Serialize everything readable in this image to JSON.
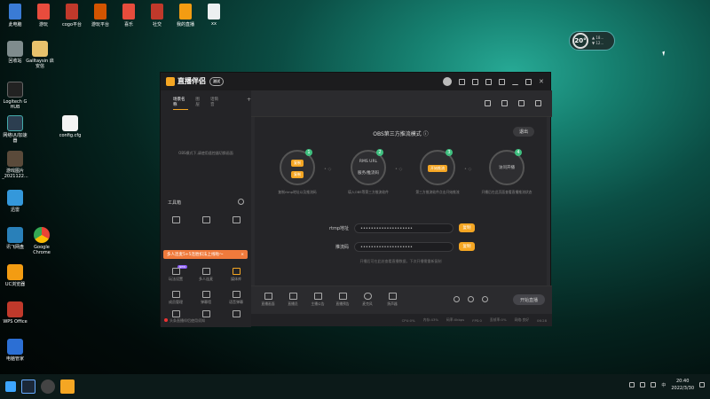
{
  "desktop": {
    "top_icons": [
      {
        "label": "此电脑",
        "color": "#3a7bd5"
      },
      {
        "label": "游玩",
        "color": "#e84c3d"
      },
      {
        "label": "cogo平台",
        "color": "#c0392b"
      },
      {
        "label": "游玩平台",
        "color": "#d35400"
      },
      {
        "label": "喜乐",
        "color": "#e74c3c"
      },
      {
        "label": "社交",
        "color": "#c0392b"
      },
      {
        "label": "我的直播",
        "color": "#f39c12"
      },
      {
        "label": "xx",
        "color": "#ecf0f1"
      }
    ],
    "left_icons": [
      {
        "label": "回收站",
        "color": "#7f8c8d"
      },
      {
        "label": "Logitech G HUB",
        "color": "#222"
      },
      {
        "label": "网络UU加速器",
        "color": "#2c3e50"
      },
      {
        "label": "游戏图片 _2021122...",
        "color": "#5a4a3a"
      },
      {
        "label": "迅雷",
        "color": "#3498db"
      },
      {
        "label": "讯飞网盘",
        "color": "#2980b9"
      },
      {
        "label": "UC浏览器",
        "color": "#f39c12"
      },
      {
        "label": "WPS Office",
        "color": "#c0392b"
      },
      {
        "label": "电脑管家",
        "color": "#2c6fd4"
      }
    ],
    "extra_icons": [
      {
        "label": "Galltaysin 启安信",
        "color": "#e8c26c"
      },
      {
        "label": "config.cfg",
        "color": "#f4f4f4"
      },
      {
        "label": "Google Chrome",
        "color": "#4285f4"
      }
    ],
    "weather": {
      "temp": "20",
      "unit": "°",
      "line1": "▲ 18...",
      "line2": "▼ 12..."
    }
  },
  "app": {
    "title": "直播伴侣",
    "beta": "测试",
    "left_tabs": [
      "场景名称",
      "图层",
      "话筒音"
    ],
    "left_tab_add": "+",
    "left_empty": "OBS模式下,请使用遥控器切换画面",
    "tools_title": "工具箱",
    "tools_row1": [
      "",
      "",
      ""
    ],
    "promo_text": "多人连麦5+5连胜扣法上线啦～",
    "promo_close": "×",
    "new_badge": "NEW",
    "tools_row2": [
      "玩法设置",
      "多人连麦",
      "媒体库"
    ],
    "tools_row3": [
      "成员管理",
      "弹幕墙",
      "语音弹幕"
    ],
    "tools_row4": [
      "",
      "",
      ""
    ],
    "footer_text": "头条直播伴侣使用须知",
    "mode_title": "OBS第三方推流模式",
    "exit_label": "退出",
    "steps": [
      {
        "num": "1",
        "chip_top": "复制",
        "chip_bottom": "复制",
        "desc": "复制rtmp地址以及推流码"
      },
      {
        "num": "2",
        "line1": "RMS URL",
        "line2": "服务/推流码",
        "desc": "填入OBS等第三方推流软件"
      },
      {
        "num": "3",
        "chip": "开始推流",
        "desc": "第三方推流软件点击开始推流"
      },
      {
        "num": "4",
        "line1": "访问开播",
        "desc": "开播后在此页面查看直播推流状态"
      }
    ],
    "rtmp_label": "rtmp地址",
    "rtmp_value": "••••••••••••••••••••",
    "key_label": "推流码",
    "key_value": "••••••••••••••••••••",
    "copy_label": "复制",
    "hint": "开播后可在此处查看直播数据，下次开播需重新复制",
    "bottom_tools": [
      "直播画面",
      "直播员",
      "主播公告",
      "直播预告",
      "麦克风",
      "扬声器"
    ],
    "start_label": "开始直播",
    "status": [
      "CPU:0%",
      "内存:43%",
      "码率:0kbps",
      "FPS:0",
      "丢帧率:0%",
      "网络:良好",
      "06:28"
    ]
  },
  "taskbar": {
    "apps": [
      {
        "name": "start",
        "color": "#3da6ff"
      },
      {
        "name": "steam",
        "color": "#1b2838"
      },
      {
        "name": "obs",
        "color": "#444"
      },
      {
        "name": "live-companion",
        "color": "#f5a623"
      }
    ],
    "ime": "中",
    "time": "20:40",
    "date": "2022/3/30"
  }
}
